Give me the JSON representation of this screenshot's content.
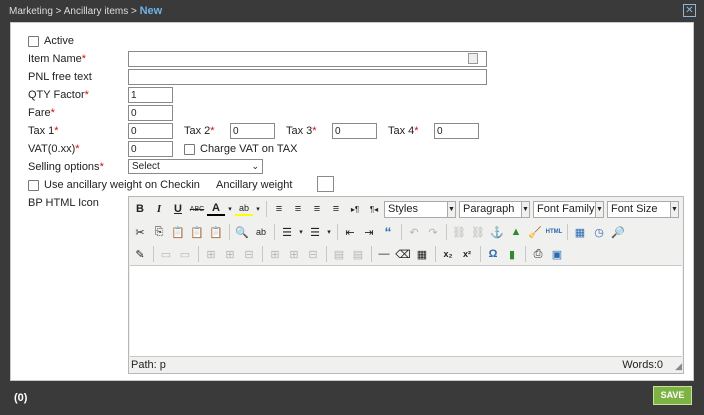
{
  "window": {
    "breadcrumb_prefix": "Marketing > Ancillary items > ",
    "breadcrumb_current": "New",
    "close_label": "✕"
  },
  "form": {
    "active_label": "Active",
    "item_name_label": "Item Name",
    "item_name_value": "",
    "pnl_label": "PNL free text",
    "pnl_value": "",
    "qty_label": "QTY Factor",
    "qty_value": "1",
    "fare_label": "Fare",
    "fare_value": "0",
    "tax1_label": "Tax 1",
    "tax1_value": "0",
    "tax2_label": "Tax 2",
    "tax2_value": "0",
    "tax3_label": "Tax 3",
    "tax3_value": "0",
    "tax4_label": "Tax 4",
    "tax4_value": "0",
    "vat_label": "VAT(0.xx)",
    "vat_value": "0",
    "charge_vat_label": "Charge VAT on TAX",
    "selling_label": "Selling options",
    "selling_value": "Select",
    "anc_weight_label": "Use ancillary weight on Checkin",
    "anc_weight2_label": "Ancillary weight",
    "bp_label": "BP HTML Icon",
    "required_mark": "*"
  },
  "editor": {
    "styles": "Styles",
    "paragraph": "Paragraph",
    "font_family": "Font Family",
    "font_size": "Font Size",
    "path": "Path: p",
    "words": "Words:0",
    "icons": {
      "bold": "B",
      "italic": "I",
      "underline": "U",
      "strike": "ABC",
      "font_color": "A",
      "highlight": "ab",
      "ltr": "▸¶",
      "rtl": "¶◂",
      "quote": "“",
      "undo": "↶",
      "redo": "↷",
      "hr": "—",
      "sub": "x₂",
      "sup": "x²",
      "omega": "Ω"
    }
  },
  "footer": {
    "count": "(0)",
    "save": "SAVE"
  },
  "colors": {
    "accent": "#6fb1e4",
    "save": "#7cb342",
    "required": "#d01010"
  }
}
